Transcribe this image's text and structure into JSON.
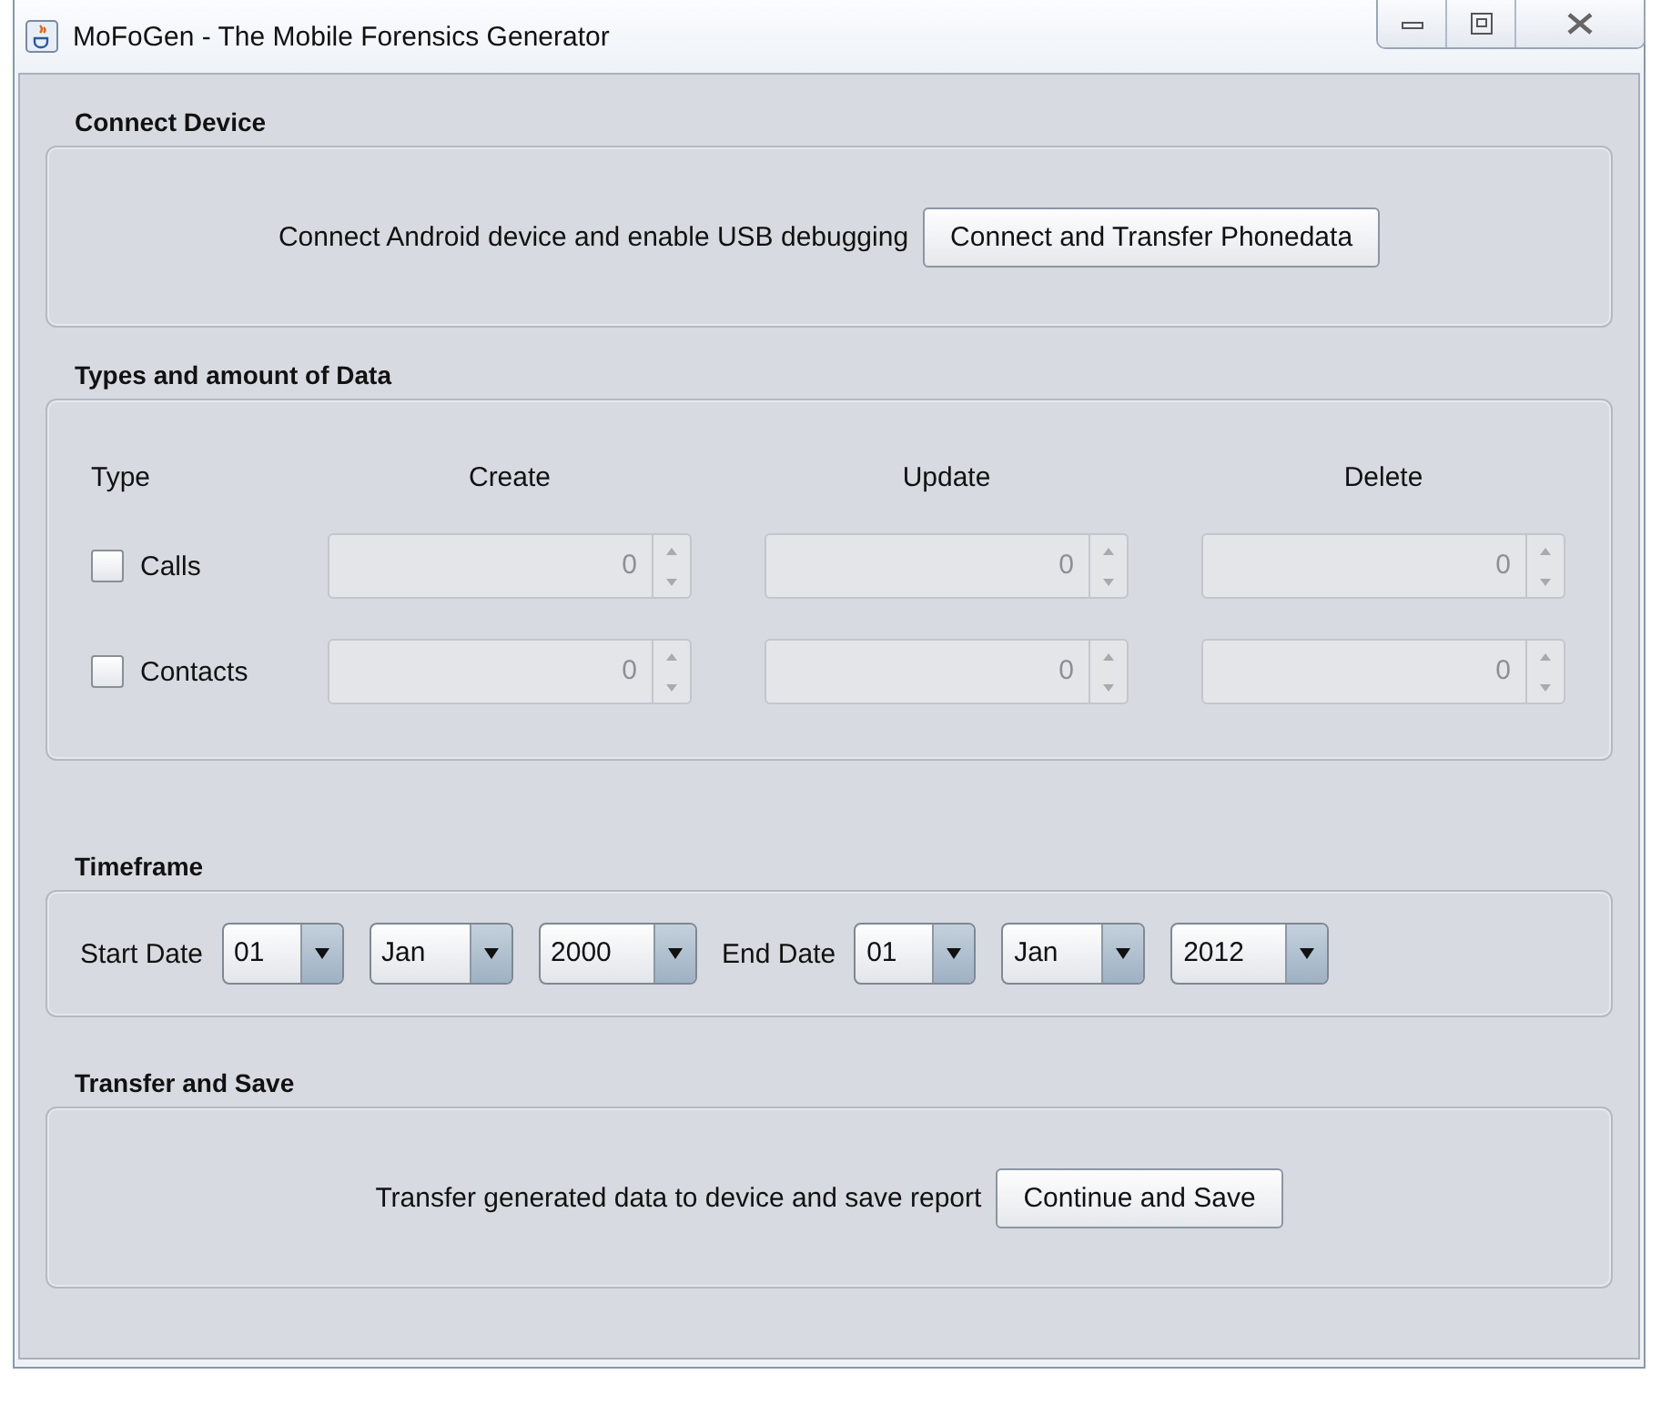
{
  "window": {
    "title": "MoFoGen - The Mobile Forensics Generator"
  },
  "connect": {
    "title": "Connect Device",
    "instruction": "Connect Android device and enable USB debugging",
    "button": "Connect and Transfer Phonedata"
  },
  "data_types": {
    "title": "Types and amount of Data",
    "columns": [
      "Type",
      "Create",
      "Update",
      "Delete"
    ],
    "rows": [
      {
        "label": "Calls",
        "checked": false,
        "spinners": [
          {
            "value": "0",
            "disabled": true
          },
          {
            "value": "0",
            "disabled": true
          },
          {
            "value": "0",
            "disabled": true
          }
        ]
      },
      {
        "label": "Contacts",
        "checked": false,
        "spinners": [
          {
            "value": "0",
            "disabled": true
          },
          {
            "value": "0",
            "disabled": true
          },
          {
            "value": "0",
            "disabled": true
          }
        ]
      }
    ]
  },
  "timeframe": {
    "title": "Timeframe",
    "groups": [
      {
        "label": "Start Date",
        "day": "01",
        "month": "Jan",
        "year": "2000"
      },
      {
        "label": "End Date",
        "day": "01",
        "month": "Jan",
        "year": "2012"
      }
    ]
  },
  "transfer": {
    "title": "Transfer and Save",
    "instruction": "Transfer generated data to device and save report",
    "button": "Continue and Save"
  }
}
